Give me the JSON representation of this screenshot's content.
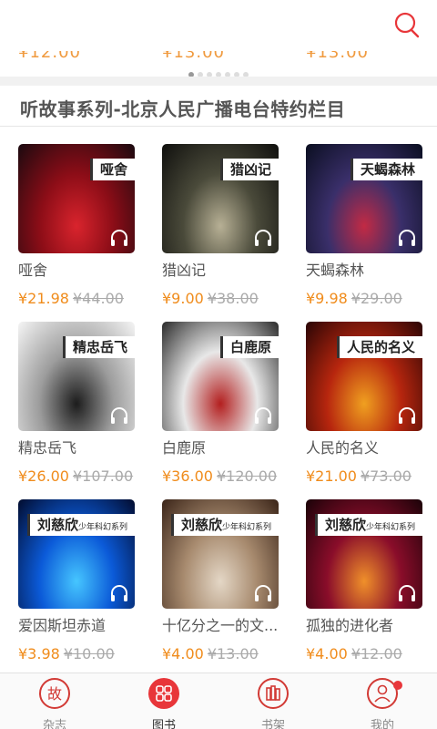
{
  "header": {
    "search_icon": "search-icon"
  },
  "carousel": {
    "peek_prices": [
      "¥12.00",
      "¥13.00",
      "¥13.00"
    ],
    "dot_count": 7,
    "active_dot": 0
  },
  "section": {
    "title": "听故事系列-北京人民广播电台特约栏目"
  },
  "books": [
    {
      "title": "哑舍",
      "tag": "哑舍",
      "price": "¥21.98",
      "original": "¥44.00",
      "colors": [
        "#1a0a0f",
        "#8c0d17",
        "#d9242d"
      ]
    },
    {
      "title": "猎凶记",
      "tag": "猎凶记",
      "price": "¥9.00",
      "original": "¥38.00",
      "colors": [
        "#0f0f0d",
        "#4a4a3a",
        "#b7b095"
      ]
    },
    {
      "title": "天蝎森林",
      "tag": "天蝎森林",
      "price": "¥9.98",
      "original": "¥29.00",
      "colors": [
        "#0a0e20",
        "#3a2f6a",
        "#c22a44"
      ]
    },
    {
      "title": "精忠岳飞",
      "tag": "精忠岳飞",
      "price": "¥26.00",
      "original": "¥107.00",
      "colors": [
        "#f5f5f5",
        "#9c9c9c",
        "#1c1c1c"
      ]
    },
    {
      "title": "白鹿原",
      "tag": "白鹿原",
      "price": "¥36.00",
      "original": "¥120.00",
      "colors": [
        "#2a2a2a",
        "#e8e8e8",
        "#b31f1f"
      ]
    },
    {
      "title": "人民的名义",
      "tag": "人民的名义",
      "price": "¥21.00",
      "original": "¥73.00",
      "colors": [
        "#2a0505",
        "#b7260e",
        "#f0a020"
      ]
    },
    {
      "title": "爱因斯坦赤道",
      "tag": "刘慈欣",
      "tag_sub": "少年科幻系列",
      "price": "¥3.98",
      "original": "¥10.00",
      "colors": [
        "#020c2e",
        "#0b5ad8",
        "#46c6ff"
      ]
    },
    {
      "title": "十亿分之一的文...",
      "tag": "刘慈欣",
      "tag_sub": "少年科幻系列",
      "price": "¥4.00",
      "original": "¥13.00",
      "colors": [
        "#3a2418",
        "#a78a6e",
        "#e4d7c6"
      ]
    },
    {
      "title": "孤独的进化者",
      "tag": "刘慈欣",
      "tag_sub": "少年科幻系列",
      "price": "¥4.00",
      "original": "¥12.00",
      "colors": [
        "#1a0208",
        "#8a0d2a",
        "#f0902a"
      ]
    }
  ],
  "pager": {
    "dot_count": 9,
    "active_dot": 0
  },
  "tabs": [
    {
      "label": "杂志",
      "icon": "magazine-icon",
      "active": false
    },
    {
      "label": "图书",
      "icon": "books-grid-icon",
      "active": true
    },
    {
      "label": "书架",
      "icon": "bookshelf-icon",
      "active": false
    },
    {
      "label": "我的",
      "icon": "profile-icon",
      "active": false,
      "badge": true
    }
  ],
  "colors": {
    "accent": "#e8363a",
    "price": "#f08c1c",
    "strike": "#aaaaaa"
  }
}
